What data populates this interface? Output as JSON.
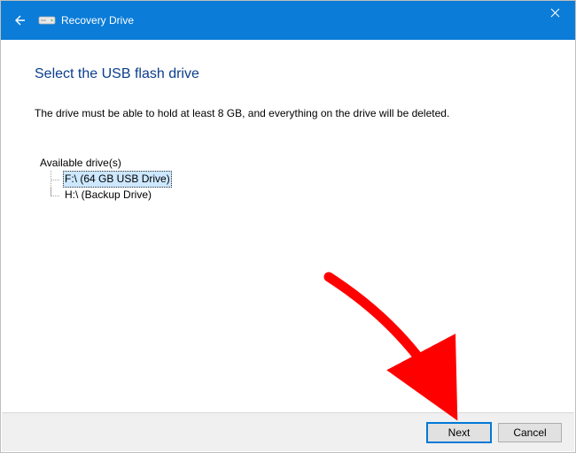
{
  "window": {
    "title": "Recovery Drive"
  },
  "page": {
    "heading": "Select the USB flash drive",
    "instruction": "The drive must be able to hold at least 8 GB, and everything on the drive will be deleted.",
    "drives_label": "Available drive(s)"
  },
  "drives": [
    {
      "label": "F:\\ (64 GB USB Drive)",
      "selected": true
    },
    {
      "label": "H:\\ (Backup Drive)",
      "selected": false
    }
  ],
  "buttons": {
    "next": "Next",
    "cancel": "Cancel"
  }
}
